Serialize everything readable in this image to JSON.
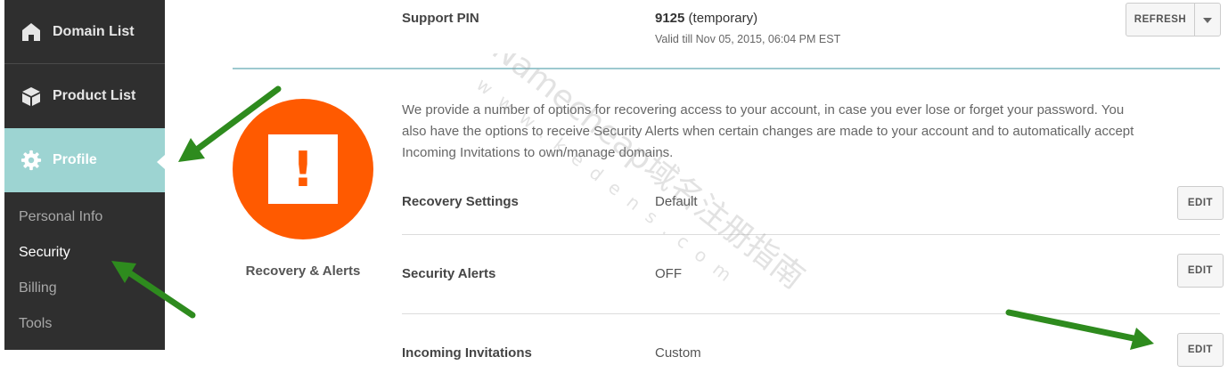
{
  "sidebar": {
    "items": [
      {
        "label": "Domain List",
        "icon": "home-icon"
      },
      {
        "label": "Product List",
        "icon": "box-icon"
      },
      {
        "label": "Profile",
        "icon": "gear-icon"
      }
    ],
    "sub_items": [
      {
        "label": "Personal Info"
      },
      {
        "label": "Security"
      },
      {
        "label": "Billing"
      },
      {
        "label": "Tools"
      }
    ]
  },
  "support_pin": {
    "label": "Support PIN",
    "pin": "9125",
    "status": "(temporary)",
    "valid_till": "Valid till Nov 05, 2015, 06:04 PM EST",
    "refresh_label": "REFRESH"
  },
  "recovery": {
    "title": "Recovery & Alerts",
    "description": "We provide a number of options for recovering access to your account, in case you ever lose or forget your password. You also have the options to receive Security Alerts when certain changes are made to your account and to automatically accept Incoming Invitations to own/manage domains.",
    "icon_symbol": "!",
    "rows": [
      {
        "label": "Recovery Settings",
        "value": "Default",
        "action": "EDIT"
      },
      {
        "label": "Security Alerts",
        "value": "OFF",
        "action": "EDIT"
      },
      {
        "label": "Incoming Invitations",
        "value": "Custom",
        "action": "EDIT"
      }
    ]
  },
  "watermark": {
    "line1": "Namecheap域名注册指南",
    "line2": "www.kedens.com"
  },
  "colors": {
    "sidebar_bg": "#2f2f2f",
    "active_bg": "#9dd4d2",
    "alert_orange": "#ff5a00",
    "annotation_arrow": "#2e8b1e"
  }
}
